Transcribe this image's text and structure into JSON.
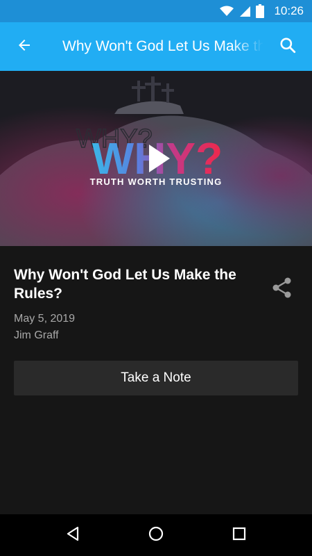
{
  "status_bar": {
    "time": "10:26",
    "icons": [
      "wifi-icon",
      "signal-icon",
      "battery-icon"
    ]
  },
  "app_bar": {
    "title": "Why Won't God Let Us Make the Rules?",
    "back_icon": "arrow-left-icon",
    "search_icon": "search-icon"
  },
  "hero": {
    "word": "WHY?",
    "tagline": "TRUTH WORTH TRUSTING",
    "play_icon": "play-icon"
  },
  "sermon": {
    "title": "Why Won't God Let Us Make the Rules?",
    "date": "May 5, 2019",
    "speaker": "Jim Graff",
    "share_icon": "share-icon",
    "note_label": "Take a Note"
  },
  "nav_bar": {
    "icons": [
      "back-triangle-icon",
      "home-circle-icon",
      "recents-square-icon"
    ]
  },
  "colors": {
    "status_bar": "#1e8fd6",
    "app_bar": "#21adf3",
    "background": "#161616",
    "button": "#2a2a2a",
    "muted_text": "#a8a8a8",
    "accent_red": "#f0284a"
  }
}
